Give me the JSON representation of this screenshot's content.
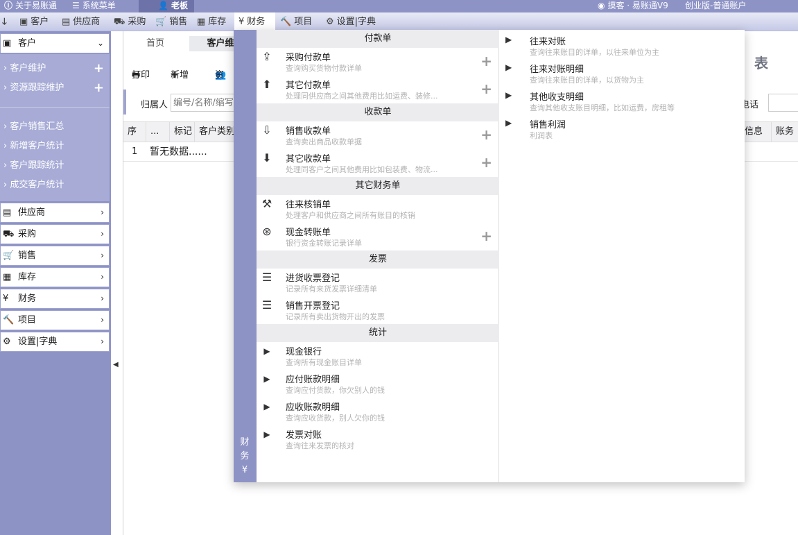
{
  "topbar": {
    "about": "关于易账通",
    "system_menu": "系统菜单",
    "user": "老板",
    "right_info": "摸客 · 易账通V9",
    "edition": "创业版-普通账户"
  },
  "nav": {
    "customer": "客户",
    "supplier": "供应商",
    "purchase": "采购",
    "sales": "销售",
    "stock": "库存",
    "finance": "财务",
    "project": "项目",
    "settings": "设置|字典"
  },
  "sidebar": {
    "customer_head": "客户",
    "sub_items": [
      {
        "label": "客户维护"
      },
      {
        "label": "资源跟踪维护"
      },
      {
        "label": "客户销售汇总"
      },
      {
        "label": "新增客户统计"
      },
      {
        "label": "客户跟踪统计"
      },
      {
        "label": "成交客户统计"
      }
    ],
    "sections": [
      {
        "label": "供应商"
      },
      {
        "label": "采购"
      },
      {
        "label": "销售"
      },
      {
        "label": "库存"
      },
      {
        "label": "财务"
      },
      {
        "label": "项目"
      },
      {
        "label": "设置|字典"
      }
    ]
  },
  "content": {
    "tab_home": "首页",
    "tab_customer": "客户维",
    "print": "打印",
    "add": "新增",
    "resource": "资",
    "owner_label": "归属人",
    "owner_placeholder": "编号/名称/缩写",
    "report_title": "表",
    "phone_label": "电话",
    "headers": [
      "序",
      "...",
      "标记",
      "客户类别",
      "信息",
      "账务"
    ],
    "row_index": "1",
    "empty_text": "暂无数据......"
  },
  "dropdown": {
    "strip_label": "财务¥",
    "sections": {
      "pay": "付款单",
      "receive": "收款单",
      "other": "其它财务单",
      "invoice": "发票",
      "stats": "统计"
    },
    "items": {
      "purchase_pay": {
        "title": "采购付款单",
        "desc": "查询购买货物付款详单"
      },
      "other_pay": {
        "title": "其它付款单",
        "desc": "处理同供应商之间其他费用比如运费、装修..."
      },
      "sales_recv": {
        "title": "销售收款单",
        "desc": "查询卖出商品收款单据"
      },
      "other_recv": {
        "title": "其它收款单",
        "desc": "处理同客户之间其他费用比如包装费、物流..."
      },
      "write_off": {
        "title": "往来核销单",
        "desc": "处理客户和供应商之间所有账目的核销"
      },
      "cash_transfer": {
        "title": "现金转账单",
        "desc": "银行资金转账记录详单"
      },
      "purchase_invoice": {
        "title": "进货收票登记",
        "desc": "记录所有来货发票详细清单"
      },
      "sales_invoice": {
        "title": "销售开票登记",
        "desc": "记录所有卖出货物开出的发票"
      },
      "cash_bank": {
        "title": "现金银行",
        "desc": "查询所有现金账目详单"
      },
      "payable": {
        "title": "应付账款明细",
        "desc": "查询应付货款，你欠别人的钱"
      },
      "receivable": {
        "title": "应收账款明细",
        "desc": "查询应收货款，别人欠你的钱"
      },
      "invoice_check": {
        "title": "发票对账",
        "desc": "查询往来发票的核对"
      }
    },
    "right": [
      {
        "title": "往来对账",
        "desc": "查询往来账目的详单，以往来单位为主"
      },
      {
        "title": "往来对账明细",
        "desc": "查询往来账目的详单，以货物为主"
      },
      {
        "title": "其他收支明细",
        "desc": "查询其他收支账目明细，比如运费，房租等"
      },
      {
        "title": "销售利润",
        "desc": "利润表"
      }
    ]
  },
  "colors": {
    "accent": "#8e93c6",
    "accent_dark": "#6d72a8",
    "sidebar_group": "#a7abd6"
  }
}
